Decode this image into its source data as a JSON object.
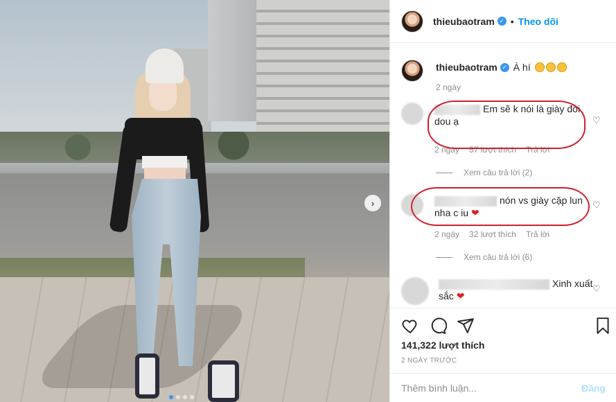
{
  "post": {
    "username": "thieubaotram",
    "follow_label": "Theo dõi",
    "caption_text": "À hí",
    "caption_age": "2 ngày",
    "likes": "141,322 lượt thích",
    "date": "2 NGÀY TRƯỚC",
    "comment_placeholder": "Thêm bình luận...",
    "post_label": "Đăng",
    "next_icon": "›",
    "carousel_dots": 4
  },
  "comments": [
    {
      "text": "Em sẽ k nói là giày đôi dou ạ",
      "age": "2 ngày",
      "likes": "57 lượt thích",
      "reply": "Trả lời",
      "view_replies": "Xem câu trả lời (2)"
    },
    {
      "text": "nón vs giày cặp lun nha c iu",
      "age": "2 ngày",
      "likes": "32 lượt thích",
      "reply": "Trả lời",
      "view_replies": "Xem câu trả lời (6)"
    },
    {
      "text": "Xinh xuất sắc"
    }
  ],
  "colors": {
    "accent": "#0095f6",
    "annotation": "#d01f2a"
  }
}
